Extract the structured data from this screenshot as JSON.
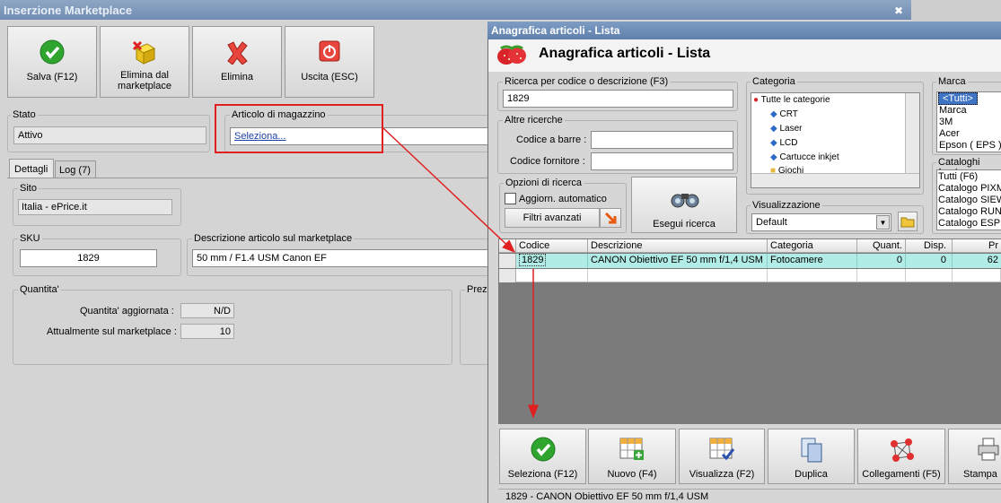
{
  "back_window": {
    "title": "Inserzione Marketplace",
    "close": "✖",
    "toolbar": [
      {
        "label": "Salva (F12)",
        "icon": "check-icon"
      },
      {
        "label": "Elimina dal marketplace",
        "icon": "cube-delete-icon"
      },
      {
        "label": "Elimina",
        "icon": "delete-x-icon"
      },
      {
        "label": "Uscita (ESC)",
        "icon": "exit-icon"
      }
    ],
    "stato": {
      "label": "Stato",
      "value": "Attivo"
    },
    "articolo": {
      "label": "Articolo di magazzino",
      "link": "Seleziona..."
    },
    "tabs": [
      "Dettagli",
      "Log (7)"
    ],
    "sito": {
      "label": "Sito",
      "value": "Italia - ePrice.it"
    },
    "sku": {
      "label": "SKU",
      "value": "1829"
    },
    "descrizione": {
      "label": "Descrizione articolo sul marketplace",
      "value": "50 mm / F1.4 USM Canon EF"
    },
    "quantita": {
      "label": "Quantita'",
      "aggiornata_label": "Quantita' aggiornata :",
      "aggiornata_value": "N/D",
      "attuale_label": "Attualmente sul marketplace :",
      "attuale_value": "10"
    },
    "prezzo_label": "Prez"
  },
  "front_window": {
    "title": "Anagrafica articoli  - Lista",
    "header_title": "Anagrafica articoli  - Lista",
    "ricerca": {
      "label": "Ricerca per codice o descrizione (F3)",
      "value": "1829"
    },
    "altre": {
      "label": "Altre ricerche",
      "barre_label": "Codice a barre :",
      "fornitore_label": "Codice fornitore :"
    },
    "opzioni": {
      "label": "Opzioni di ricerca",
      "check_label": "Aggiorn. automatico",
      "filtri_label": "Filtri avanzati"
    },
    "esegui_label": "Esegui ricerca",
    "categoria": {
      "label": "Categoria",
      "items": [
        "Tutte le categorie",
        "CRT",
        "Laser",
        "LCD",
        "Cartucce inkjet",
        "Giochi"
      ]
    },
    "visualizzazione": {
      "label": "Visualizzazione",
      "value": "Default"
    },
    "marca": {
      "label": "Marca",
      "items": [
        "<Tutti>",
        "Marca",
        "3M",
        "Acer",
        "Epson ( EPS )"
      ]
    },
    "cataloghi": {
      "label": "Cataloghi forni",
      "items": [
        "Tutti (F6)",
        "Catalogo PIXM",
        "Catalogo SIEW",
        "Catalogo RUNST",
        "Catalogo ESPRI"
      ]
    },
    "grid": {
      "headers": [
        "Codice",
        "Descrizione",
        "Categoria",
        "Quant.",
        "Disp.",
        "Pr"
      ],
      "row": [
        "1829",
        "CANON Obiettivo EF 50 mm f/1,4 USM",
        "Fotocamere",
        "0",
        "0",
        "62"
      ]
    },
    "buttons": [
      {
        "label": "Seleziona (F12)",
        "icon": "check-icon"
      },
      {
        "label": "Nuovo (F4)",
        "icon": "grid-add-icon"
      },
      {
        "label": "Visualizza (F2)",
        "icon": "grid-check-icon"
      },
      {
        "label": "Duplica",
        "icon": "duplicate-icon"
      },
      {
        "label": "Collegamenti (F5)",
        "icon": "links-icon"
      },
      {
        "label": "Stampa",
        "icon": "printer-icon"
      }
    ],
    "status": "1829 - CANON Obiettivo EF 50 mm f/1,4 USM"
  },
  "colors": {
    "highlight": "#e02020",
    "row": "#b2ece6",
    "title": "#6f8cb2"
  }
}
